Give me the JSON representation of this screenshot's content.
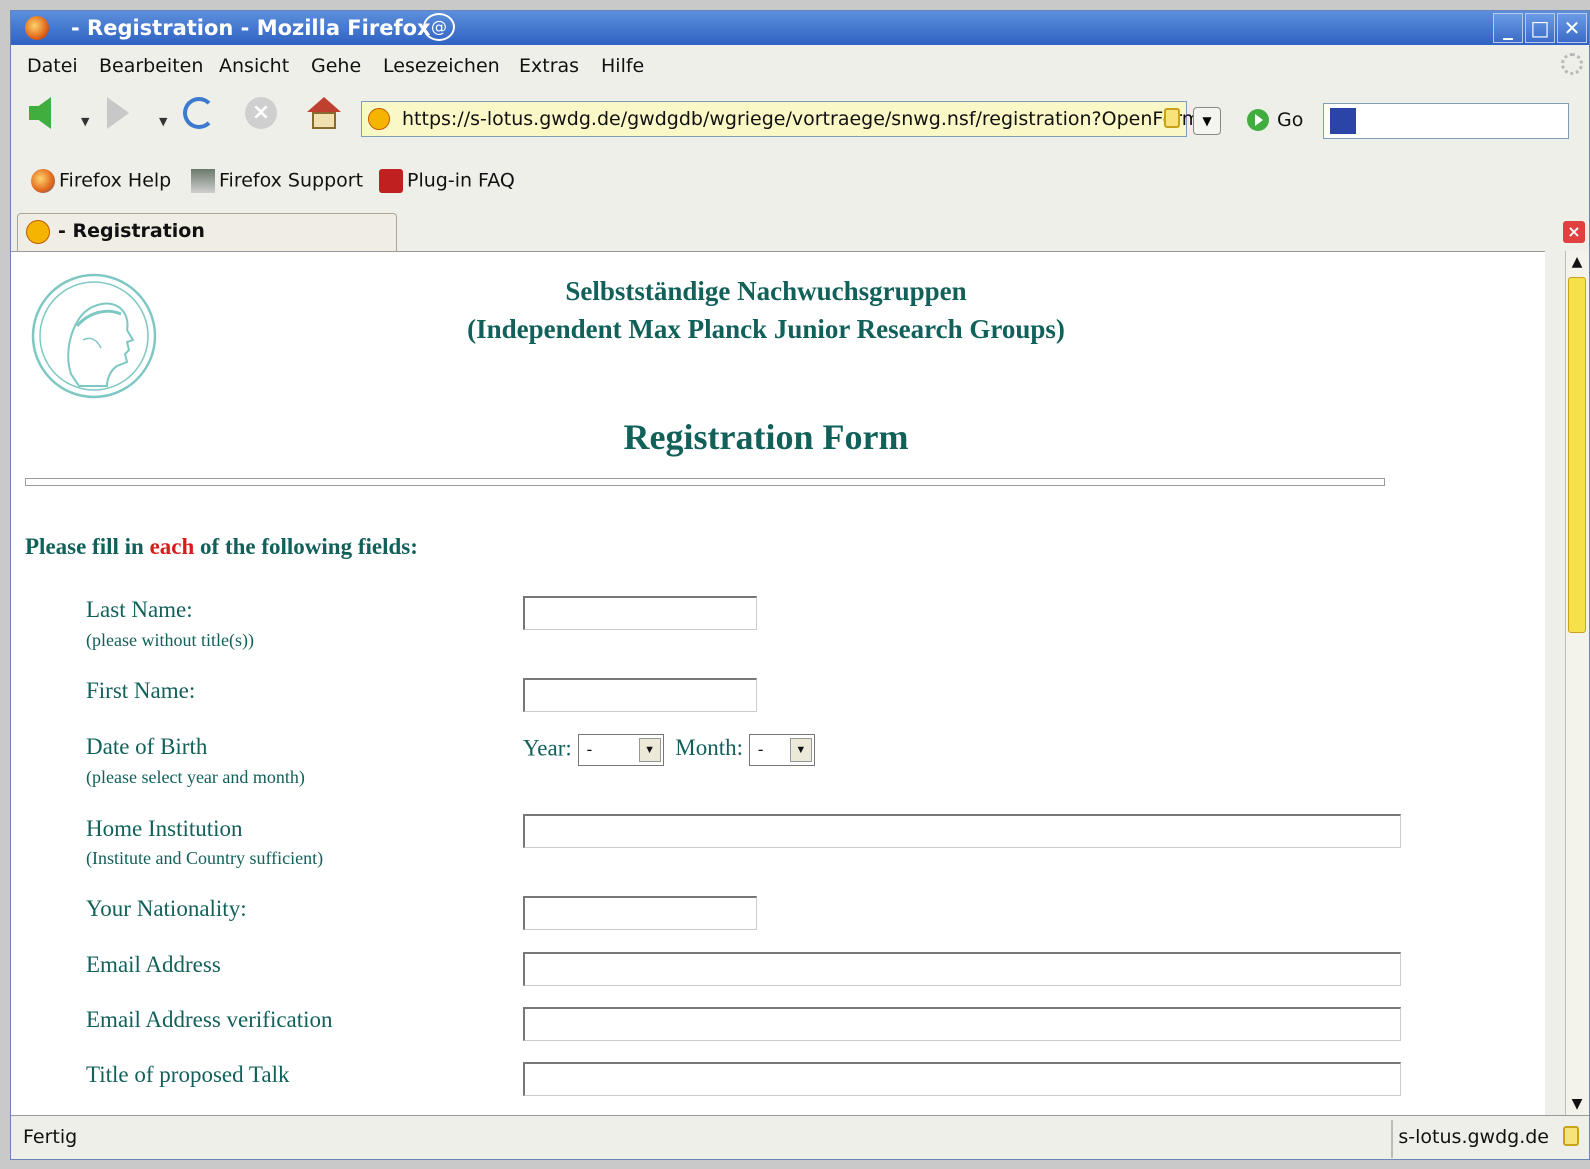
{
  "window": {
    "title": "- Registration - Mozilla Firefox",
    "controls": [
      "_",
      "□",
      "✕"
    ]
  },
  "menu": [
    "Datei",
    "Bearbeiten",
    "Ansicht",
    "Gehe",
    "Lesezeichen",
    "Extras",
    "Hilfe"
  ],
  "toolbar": {
    "url": "https://s-lotus.gwdg.de/gwdgdb/wgriege/vortraege/snwg.nsf/registration?OpenForm",
    "go_label": "Go"
  },
  "bookmarks": [
    {
      "label": "Firefox Help",
      "icon": "firefox-icon"
    },
    {
      "label": "Firefox Support",
      "icon": "zine-icon"
    },
    {
      "label": "Plug-in FAQ",
      "icon": "plugin-icon"
    }
  ],
  "tab": {
    "label": "- Registration"
  },
  "page": {
    "heading_line1": "Selbstständige Nachwuchsgruppen",
    "heading_line2": "(Independent Max Planck Junior Research Groups)",
    "form_title": "Registration Form",
    "intro_before": "Please fill in ",
    "intro_highlight": "each",
    "intro_after": " of the following fields:",
    "fields": {
      "last_name": {
        "label": "Last Name:",
        "hint": "(please without title(s))"
      },
      "first_name": {
        "label": "First Name:"
      },
      "dob": {
        "label": "Date of Birth",
        "hint": "(please select year and month)",
        "year_label": "Year:",
        "year_value": "-",
        "month_label": "Month:",
        "month_value": "-"
      },
      "institution": {
        "label": "Home Institution",
        "hint": "(Institute and Country sufficient)"
      },
      "nationality": {
        "label": "Your Nationality:"
      },
      "email": {
        "label": "Email Address"
      },
      "email_verify": {
        "label": "Email Address verification"
      },
      "talk_title": {
        "label": "Title of proposed Talk"
      }
    }
  },
  "status": {
    "text": "Fertig",
    "host": "s-lotus.gwdg.de"
  }
}
